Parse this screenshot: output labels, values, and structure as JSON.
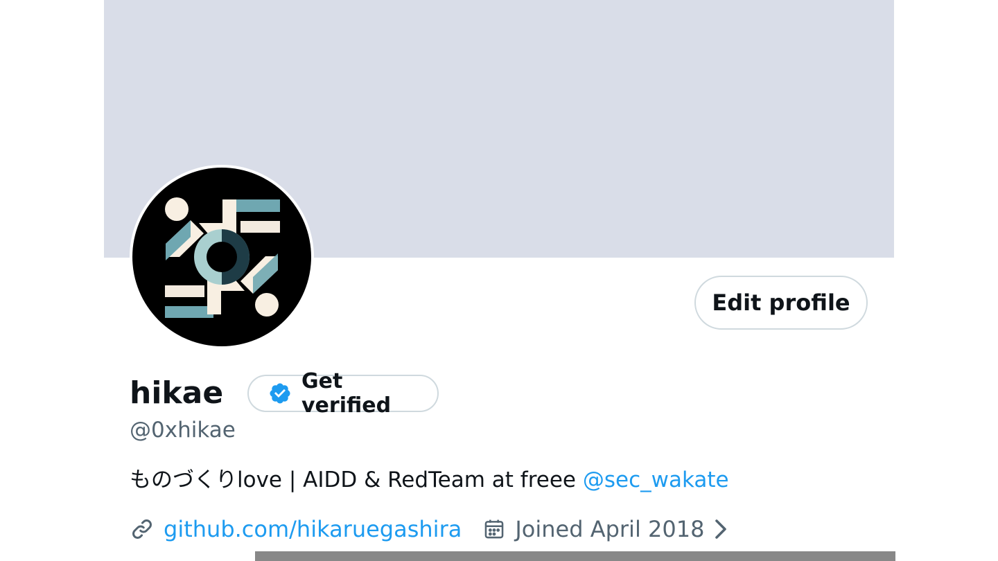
{
  "profile": {
    "display_name": "hikae",
    "handle": "@0xhikae",
    "bio_text": "ものづくりlove | AIDD & RedTeam at freee ",
    "bio_mention": "@sec_wakate",
    "website": "github.com/hikaruegashira",
    "joined": "Joined April 2018"
  },
  "actions": {
    "edit_profile_label": "Edit profile",
    "get_verified_label": "Get verified"
  },
  "icons": {
    "verified": "verified-badge-icon",
    "link": "link-icon",
    "calendar": "calendar-icon",
    "chevron": "chevron-right-icon"
  },
  "colors": {
    "banner": "#d9dde8",
    "accent": "#1d9bf0",
    "secondary_text": "#536471",
    "primary_text": "#0f1419",
    "border": "#cfd9de"
  }
}
